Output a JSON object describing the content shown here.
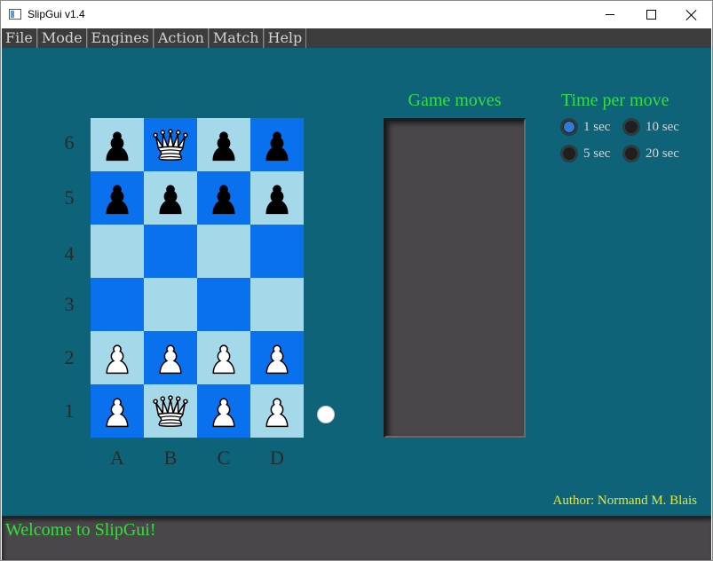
{
  "window": {
    "title": "SlipGui v1.4"
  },
  "menu": [
    "File",
    "Mode",
    "Engines",
    "Action",
    "Match",
    "Help"
  ],
  "board": {
    "ranks": [
      "6",
      "5",
      "4",
      "3",
      "2",
      "1"
    ],
    "files": [
      "A",
      "B",
      "C",
      "D"
    ],
    "squares": [
      [
        {
          "shade": "light",
          "piece": "black-pawn"
        },
        {
          "shade": "dark",
          "piece": "white-queen"
        },
        {
          "shade": "light",
          "piece": "black-pawn"
        },
        {
          "shade": "dark",
          "piece": "black-pawn"
        }
      ],
      [
        {
          "shade": "dark",
          "piece": "black-pawn"
        },
        {
          "shade": "light",
          "piece": "black-pawn"
        },
        {
          "shade": "dark",
          "piece": "black-pawn"
        },
        {
          "shade": "light",
          "piece": "black-pawn"
        }
      ],
      [
        {
          "shade": "light",
          "piece": ""
        },
        {
          "shade": "dark",
          "piece": ""
        },
        {
          "shade": "light",
          "piece": ""
        },
        {
          "shade": "dark",
          "piece": ""
        }
      ],
      [
        {
          "shade": "dark",
          "piece": ""
        },
        {
          "shade": "light",
          "piece": ""
        },
        {
          "shade": "dark",
          "piece": ""
        },
        {
          "shade": "light",
          "piece": ""
        }
      ],
      [
        {
          "shade": "light",
          "piece": "white-pawn"
        },
        {
          "shade": "dark",
          "piece": "white-pawn"
        },
        {
          "shade": "light",
          "piece": "white-pawn"
        },
        {
          "shade": "dark",
          "piece": "white-pawn"
        }
      ],
      [
        {
          "shade": "dark",
          "piece": "white-pawn"
        },
        {
          "shade": "light",
          "piece": "white-queen"
        },
        {
          "shade": "dark",
          "piece": "white-pawn"
        },
        {
          "shade": "light",
          "piece": "white-pawn"
        }
      ]
    ],
    "turn_indicator": "white"
  },
  "game_moves": {
    "title": "Game moves",
    "moves": []
  },
  "time_per_move": {
    "title": "Time per move",
    "options": [
      {
        "label": "1 sec",
        "checked": true
      },
      {
        "label": "10 sec",
        "checked": false
      },
      {
        "label": "5 sec",
        "checked": false
      },
      {
        "label": "20 sec",
        "checked": false
      }
    ]
  },
  "author": "Author: Normand M. Blais",
  "status": "Welcome to SlipGui!",
  "colors": {
    "background": "#0e6379",
    "light_square": "#a5d9ea",
    "dark_square": "#0a71ee",
    "accent_green": "#2fe13a",
    "author_yellow": "#e6e83a",
    "panel": "#4a464a"
  }
}
